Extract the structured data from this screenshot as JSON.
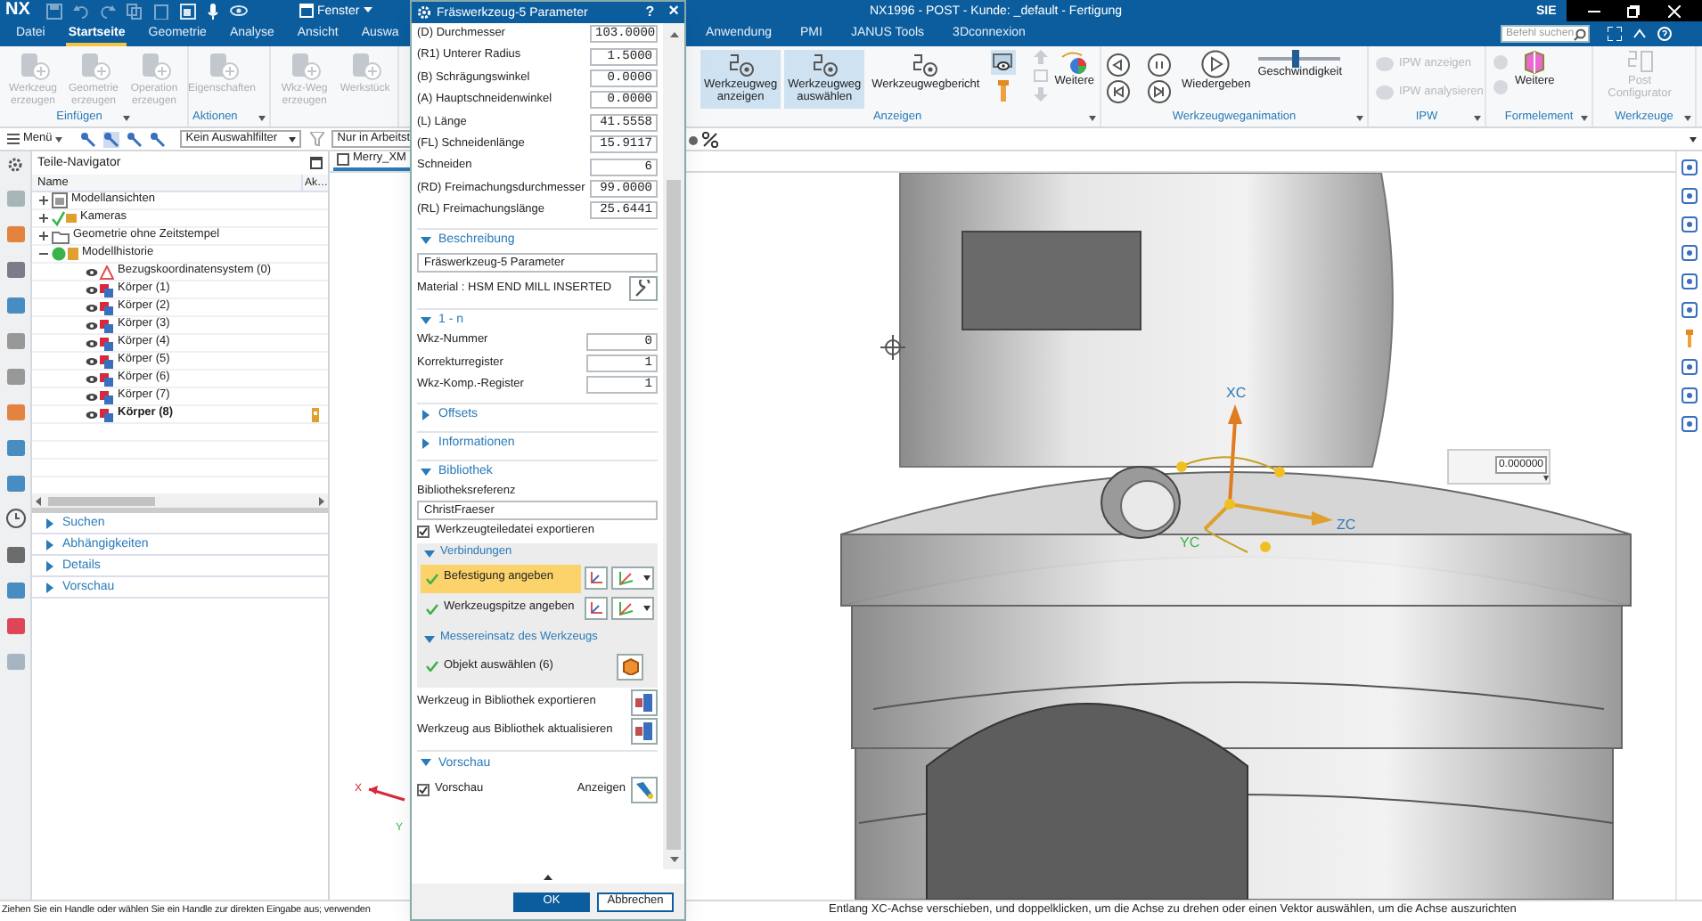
{
  "window": {
    "brand": "NX",
    "menu": "Fenster",
    "title": "NX1996 - POST - Kunde: _default - Fertigung",
    "vendor": "SIE"
  },
  "tabs_left": [
    {
      "label": "Datei",
      "selected": false
    },
    {
      "label": "Startseite",
      "selected": true
    },
    {
      "label": "Geometrie",
      "selected": false
    },
    {
      "label": "Analyse",
      "selected": false
    },
    {
      "label": "Ansicht",
      "selected": false
    },
    {
      "label": "Auswa",
      "selected": false
    }
  ],
  "tabs_right": [
    {
      "label": "Anwendung",
      "selected": false
    },
    {
      "label": "PMI",
      "selected": false
    },
    {
      "label": "JANUS Tools",
      "selected": false
    },
    {
      "label": "3Dconnexion",
      "selected": false
    }
  ],
  "command_search": {
    "placeholder": "Befehl suchen"
  },
  "ribbon_left": [
    {
      "label": "Einfügen",
      "buttons": [
        {
          "label": "Werkzeug erzeugen",
          "disabled": true
        },
        {
          "label": "Geometrie erzeugen",
          "disabled": true
        },
        {
          "label": "Operation erzeugen",
          "disabled": true
        }
      ]
    },
    {
      "label": "Aktionen",
      "buttons": [
        {
          "label": "Eigenschaften",
          "disabled": true
        }
      ]
    },
    {
      "buttons": [
        {
          "label": "Wkz-Weg erzeugen",
          "disabled": true
        },
        {
          "label": "Werkstück",
          "disabled": true
        }
      ]
    }
  ],
  "ribbon_right": {
    "display": {
      "label": "Anzeigen",
      "buttons": [
        {
          "label": "Werkzeugweg anzeigen",
          "selected": true
        },
        {
          "label": "Werkzeugweg auswählen",
          "selected": true
        },
        {
          "label": "Werkzeugwegbericht",
          "selected": false
        }
      ],
      "toggle": {
        "selected": true
      },
      "more": "Weitere"
    },
    "animation": {
      "label": "Werkzeugweganimation",
      "play": "Wiedergeben",
      "speed": {
        "label": "Geschwindigkeit",
        "level": 0.45
      }
    },
    "ipw": {
      "label": "IPW",
      "buttons": [
        {
          "label": "IPW anzeigen",
          "disabled": true
        },
        {
          "label": "IPW analysieren",
          "disabled": true
        }
      ]
    },
    "feature": {
      "label": "Formelement",
      "more": "Weitere"
    },
    "tools": {
      "label": "Werkzeuge",
      "buttons": [
        {
          "label": "Post Configurator",
          "disabled": true
        }
      ]
    }
  },
  "toolbar": {
    "menu": "Menü",
    "filter": "Kein Auswahlfilter",
    "scope": "Nur in Arbeitst"
  },
  "navigator": {
    "title": "Teile-Navigator",
    "columns": [
      "Name",
      "Ak…"
    ],
    "tree": [
      {
        "label": "Modellansichten",
        "kind": "views",
        "expanded": false
      },
      {
        "label": "Kameras",
        "kind": "cameras",
        "expanded": false
      },
      {
        "label": "Geometrie ohne Zeitstempel",
        "kind": "folder",
        "expanded": false
      },
      {
        "label": "Modellhistorie",
        "kind": "history",
        "expanded": true,
        "children": [
          {
            "label": "Bezugskoordinatensystem (0)",
            "kind": "csys",
            "current": false
          },
          {
            "label": "Körper (1)",
            "kind": "body",
            "current": false
          },
          {
            "label": "Körper (2)",
            "kind": "body",
            "current": false
          },
          {
            "label": "Körper (3)",
            "kind": "body",
            "current": false
          },
          {
            "label": "Körper (4)",
            "kind": "body",
            "current": false
          },
          {
            "label": "Körper (5)",
            "kind": "body",
            "current": false
          },
          {
            "label": "Körper (6)",
            "kind": "body",
            "current": false
          },
          {
            "label": "Körper (7)",
            "kind": "body",
            "current": false
          },
          {
            "label": "Körper (8)",
            "kind": "body",
            "current": true
          }
        ]
      }
    ],
    "sections": [
      {
        "label": "Suchen",
        "expanded": false
      },
      {
        "label": "Abhängigkeiten",
        "expanded": false
      },
      {
        "label": "Details",
        "expanded": false
      },
      {
        "label": "Vorschau",
        "expanded": false
      }
    ]
  },
  "graphics": {
    "tab": "Merry_XM",
    "value": "0.000000",
    "axes": {
      "x": "XC",
      "y": "YC",
      "z": "ZC"
    },
    "triad": {
      "x": "X",
      "y": "Y"
    }
  },
  "dialog": {
    "title": "Fräswerkzeug-5 Parameter",
    "help": "?",
    "close": "×",
    "parameters": [
      {
        "label": "(D) Durchmesser",
        "value": "103.0000"
      },
      {
        "label": "(R1) Unterer Radius",
        "value": "1.5000"
      },
      {
        "label": "(B) Schrägungswinkel",
        "value": "0.0000"
      },
      {
        "label": "(A) Hauptschneidenwinkel",
        "value": "0.0000"
      },
      {
        "label": "(L) Länge",
        "value": "41.5558"
      },
      {
        "label": "(FL) Schneidenlänge",
        "value": "15.9117"
      },
      {
        "label": "Schneiden",
        "value": "6"
      },
      {
        "label": "(RD) Freimachungsdurchmesser",
        "value": "99.0000"
      },
      {
        "label": "(RL) Freimachungslänge",
        "value": "25.6441"
      }
    ],
    "description": {
      "label": "Beschreibung",
      "expanded": true,
      "value": "Fräswerkzeug-5 Parameter",
      "material": "Material : HSM END MILL INSERTED"
    },
    "numbering": {
      "label": "1 - n",
      "expanded": true,
      "fields": [
        {
          "label": "Wkz-Nummer",
          "value": "0"
        },
        {
          "label": "Korrekturregister",
          "value": "1"
        },
        {
          "label": "Wkz-Komp.-Register",
          "value": "1"
        }
      ]
    },
    "collapsed": [
      {
        "label": "Offsets",
        "expanded": false
      },
      {
        "label": "Informationen",
        "expanded": false
      }
    ],
    "library": {
      "label": "Bibliothek",
      "expanded": true,
      "reference_label": "Bibliotheksreferenz",
      "reference": "ChristFraeser",
      "export_part": {
        "label": "Werkzeugteiledatei exportieren",
        "checked": true
      },
      "connections": {
        "label": "Verbindungen",
        "expanded": true,
        "items": [
          {
            "label": "Befestigung angeben",
            "selected": true
          },
          {
            "label": "Werkzeugspitze angeben",
            "selected": false
          }
        ]
      },
      "insert": {
        "label": "Messereinsatz des Werkzeugs",
        "expanded": true,
        "item": "Objekt auswählen (6)"
      },
      "actions": [
        "Werkzeug in Bibliothek exportieren",
        "Werkzeug aus Bibliothek aktualisieren"
      ]
    },
    "preview": {
      "label": "Vorschau",
      "expanded": true,
      "checkbox": {
        "label": "Vorschau",
        "checked": true
      },
      "show": "Anzeigen"
    },
    "buttons": [
      "OK",
      "Abbrechen"
    ]
  },
  "status_bar": {
    "left": "Ziehen Sie ein Handle oder wählen Sie ein Handle zur direkten Eingabe aus; verwenden",
    "right": "Entlang XC-Achse verschieben, und doppelklicken, um die Achse zu drehen oder einen Vektor auswählen, um die Achse auszurichten"
  }
}
